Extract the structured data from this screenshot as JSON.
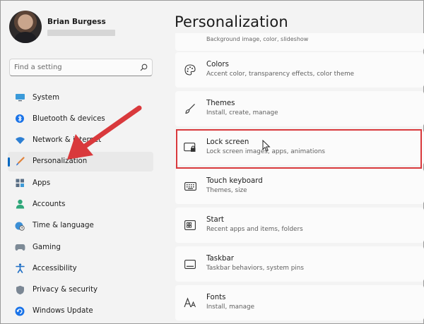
{
  "profile": {
    "name": "Brian Burgess"
  },
  "search": {
    "placeholder": "Find a setting"
  },
  "nav": {
    "items": [
      {
        "label": "System",
        "icon": "monitor-icon"
      },
      {
        "label": "Bluetooth & devices",
        "icon": "bluetooth-icon"
      },
      {
        "label": "Network & internet",
        "icon": "wifi-icon"
      },
      {
        "label": "Personalization",
        "icon": "paintbrush-icon",
        "active": true
      },
      {
        "label": "Apps",
        "icon": "apps-icon"
      },
      {
        "label": "Accounts",
        "icon": "person-icon"
      },
      {
        "label": "Time & language",
        "icon": "globe-clock-icon"
      },
      {
        "label": "Gaming",
        "icon": "gamepad-icon"
      },
      {
        "label": "Accessibility",
        "icon": "accessibility-icon"
      },
      {
        "label": "Privacy & security",
        "icon": "shield-icon"
      },
      {
        "label": "Windows Update",
        "icon": "update-icon"
      }
    ]
  },
  "main": {
    "title": "Personalization",
    "partial_card": {
      "desc": "Background image, color, slideshow"
    },
    "cards": [
      {
        "title": "Colors",
        "desc": "Accent color, transparency effects, color theme",
        "icon": "palette-icon"
      },
      {
        "title": "Themes",
        "desc": "Install, create, manage",
        "icon": "brush-icon"
      },
      {
        "title": "Lock screen",
        "desc": "Lock screen images, apps, animations",
        "icon": "lock-screen-icon"
      },
      {
        "title": "Touch keyboard",
        "desc": "Themes, size",
        "icon": "keyboard-icon"
      },
      {
        "title": "Start",
        "desc": "Recent apps and items, folders",
        "icon": "start-icon"
      },
      {
        "title": "Taskbar",
        "desc": "Taskbar behaviors, system pins",
        "icon": "taskbar-icon"
      },
      {
        "title": "Fonts",
        "desc": "Install, manage",
        "icon": "fonts-icon"
      }
    ]
  },
  "colors": {
    "accent": "#0067c0",
    "annotation_red": "#d9393c",
    "window_bg": "#f3f3f3",
    "card_bg": "#fbfbfb"
  }
}
